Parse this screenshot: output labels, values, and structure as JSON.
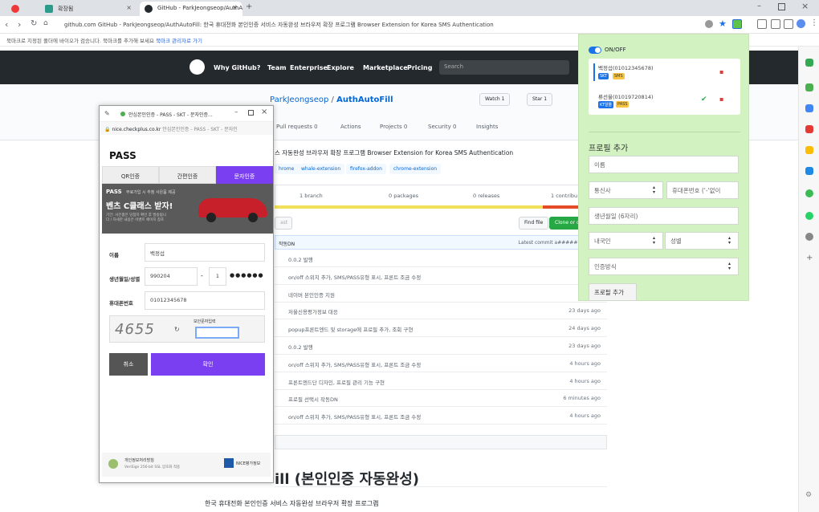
{
  "browser": {
    "tabs": [
      {
        "label": "",
        "icon": "vivaldi-icon"
      },
      {
        "label": "확장됨",
        "icon": "bookmark-icon"
      },
      {
        "label": "GitHub - ParkJeongseop/AuthA",
        "icon": "github-icon"
      }
    ],
    "url": "github.com GitHub - ParkJeongseop/AuthAutoFill: 한국 휴대전화 본인인증 서비스 자동완성 브라우저 확장 프로그램 Browser Extension for Korea SMS Authentication",
    "bookmark_text": "북마크로 지정된 폴더에 바이오가 검승니다. 북마크를 추가해 보세요",
    "bookmark_link": "북마크 관리자로 가기",
    "new_tab": "+"
  },
  "github": {
    "nav": [
      "Why GitHub?",
      "Team",
      "Enterprise",
      "Explore",
      "Marketplace",
      "Pricing"
    ],
    "search_placeholder": "Search",
    "owner": "ParkJeongseop",
    "sep": "/",
    "repo": "AuthAutoFill",
    "watch": "Watch",
    "watch_count": "1",
    "star": "Star",
    "star_count": "1",
    "tabs": [
      "Pull requests",
      "Actions",
      "Projects",
      "Security",
      "Insights"
    ],
    "tab_counts": [
      "0",
      "",
      "0",
      "0",
      ""
    ],
    "description": "스 자동완성 브라우저 확장 프로그램 Browser Extension for Korea SMS Authentication",
    "topics": [
      "hrome",
      "whale-extension",
      "firefox-addon",
      "chrome-extension"
    ],
    "branch": "1 branch",
    "packages": "0 packages",
    "releases": "0 releases",
    "contrib": "1 contribu",
    "find_file": "Find file",
    "clone": "Clone or d",
    "latest_left": "작동DN",
    "latest_right": "Latest commit a######a 6 min",
    "commits": [
      {
        "msg": "0.0.2 발행",
        "time": "23 d"
      },
      {
        "msg": "on/off 스위치 추가, SMS/PASS유형 표시, 프론트 조금 수정",
        "time": "4 ho"
      },
      {
        "msg": "네이버 본인인증 지원",
        "time": "1 minu"
      },
      {
        "msg": "저울신용평가정보 대응",
        "time": "23 days ago"
      },
      {
        "msg": "popup프론트엔드 및 storage에 프로필 추가, 조회 구현",
        "time": "24 days ago"
      },
      {
        "msg": "0.0.2 발행",
        "time": "23 days ago"
      },
      {
        "msg": "on/off 스위치 추가, SMS/PASS유형 표시, 프론트 조금 수정",
        "time": "4 hours ago"
      },
      {
        "msg": "프론트엔드단 디자인, 프로필 관리 기능 구현",
        "time": "4 hours ago"
      },
      {
        "msg": "프로필 선택시 작동DN",
        "time": "6 minutes ago"
      },
      {
        "msg": "on/off 스위치 추가, SMS/PASS유형 표시, 프론트 조금 수정",
        "time": "4 hours ago"
      }
    ],
    "readme_title": "ill (본인인증 자동완성)",
    "readme_desc": "한국 휴대전화 본인인증 서비스 자동완성 브라우저 확장 프로그램"
  },
  "popup": {
    "title_bar": "안심본인인증 - PASS - SKT - 문자인증...",
    "url_domain": "nice.checkplus.co.kr",
    "url_title": "안심본인인증 - PASS - SKT - 문자인",
    "brand": "PASS",
    "tabs": [
      "QR인증",
      "간편인증",
      "문자인증"
    ],
    "banner_brand": "PASS",
    "banner_line1": "무료가입 시 추첨 사은품 제공",
    "banner_big": "벤츠 C클래스 받자!",
    "banner_small": "기간: 사은품은 당첨자 확인 후 발송됩니다 / 자세한 내용은 이벤트 페이지 참조",
    "name_label": "이름",
    "name_value": "백정섭",
    "dob_label": "생년월일/성별",
    "dob_value": "990204",
    "dob_dash": "-",
    "gender_digit": "1",
    "dob_mask": "●●●●●●",
    "phone_label": "휴대폰번호",
    "phone_value": "01012345678",
    "captcha": "4655",
    "captcha_label": "보안문자입력",
    "cancel": "취소",
    "confirm": "확인",
    "footer_left": "개인정보처리방침",
    "footer_sub": "VeriSign 256-bit SSL 암호화 적용",
    "footer_right": "NICE평가정보"
  },
  "extension": {
    "toggle_label": "ON/OFF",
    "profiles": [
      {
        "name": "백정섭(01012345678)",
        "tag1": "SKT",
        "tag2": "SMS"
      },
      {
        "name": "류선율(01019720814)",
        "tag1": "KT알뜰",
        "tag2": "PASS"
      }
    ],
    "section_title": "프로필 추가",
    "name_ph": "이름",
    "carrier_ph": "통신사",
    "phone_ph": "휴대폰번호 ('-'없이",
    "dob_ph": "생년월일 (6자리)",
    "nation_ph": "내국인",
    "gender_ph": "성별",
    "auth_ph": "인증방식",
    "add_btn": "프로필 추가",
    "colors": {
      "bg": "#d2f2c1",
      "toggle": "#1a73e8"
    }
  }
}
